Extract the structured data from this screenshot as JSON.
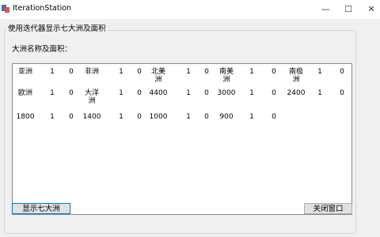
{
  "window": {
    "title": "IterationStation",
    "controls": {
      "minimize": "—",
      "maximize": "☐",
      "close": "✕"
    }
  },
  "group": {
    "title": "使用迭代器显示七大洲及面积",
    "subtitle": "大洲名称及面积："
  },
  "output": {
    "rows": [
      [
        "亚洲",
        "1",
        "0",
        "非洲",
        "1",
        "0",
        "北美洲",
        "1",
        "0",
        "南美洲",
        "1",
        "0",
        "南极洲",
        "1",
        "0"
      ],
      [
        "欧洲",
        "1",
        "0",
        "大洋洲",
        "1",
        "0",
        "4400",
        "1",
        "0",
        "3000",
        "1",
        "0",
        "2400",
        "1",
        "0"
      ],
      [
        "1800",
        "1",
        "0",
        "1400",
        "1",
        "0",
        "1000",
        "1",
        "0",
        "900",
        "1",
        "0"
      ]
    ]
  },
  "buttons": {
    "show": "显示七大洲",
    "close": "关闭窗口"
  }
}
